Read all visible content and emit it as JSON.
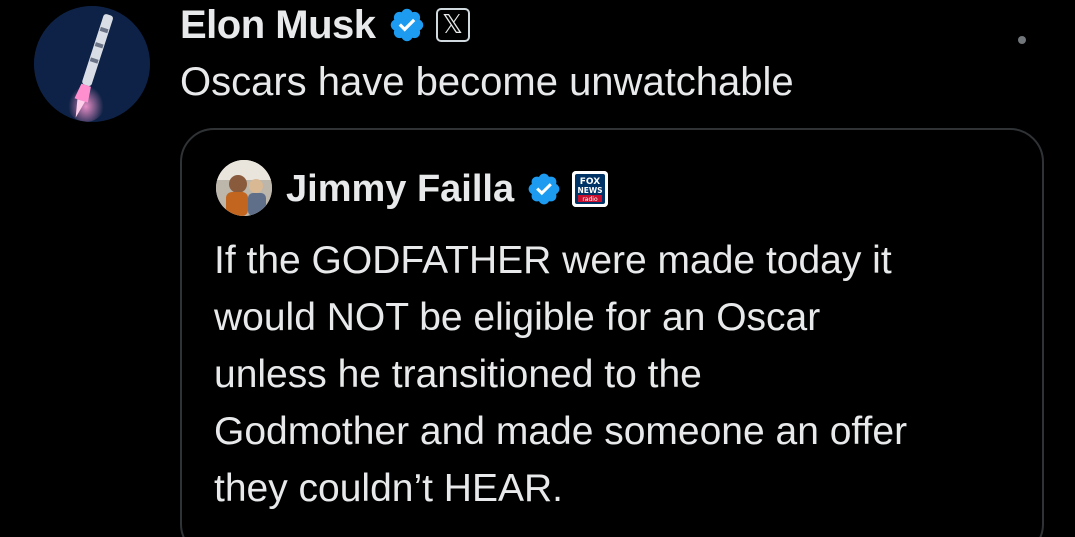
{
  "tweet": {
    "author_name": "Elon Musk",
    "avatar_icon": "rocket-launch-avatar",
    "verified_icon": "verified-badge-icon",
    "affiliate_icon": "x-logo-icon",
    "affiliate_glyph": "𝕏",
    "text": "Oscars have become unwatchable",
    "more_icon": "more-options-icon"
  },
  "quote": {
    "author_name": "Jimmy Failla",
    "avatar_icon": "profile-photo-avatar",
    "verified_icon": "verified-badge-icon",
    "affiliate_icon": "fox-news-radio-icon",
    "affiliate_text": {
      "line1": "FOX",
      "line2": "NEWS",
      "line3": "radio"
    },
    "lines": [
      "If the GODFATHER were made today it",
      "would NOT be eligible for an Oscar",
      "unless he transitioned to the",
      "Godmother and made someone an offer",
      "they couldn’t HEAR."
    ]
  },
  "colors": {
    "background": "#000000",
    "text": "#e7e9ea",
    "verified_blue": "#1d9bf0",
    "card_border": "#2f3336",
    "muted": "#71767b",
    "fox_red": "#c8102e",
    "fox_blue": "#003366"
  }
}
